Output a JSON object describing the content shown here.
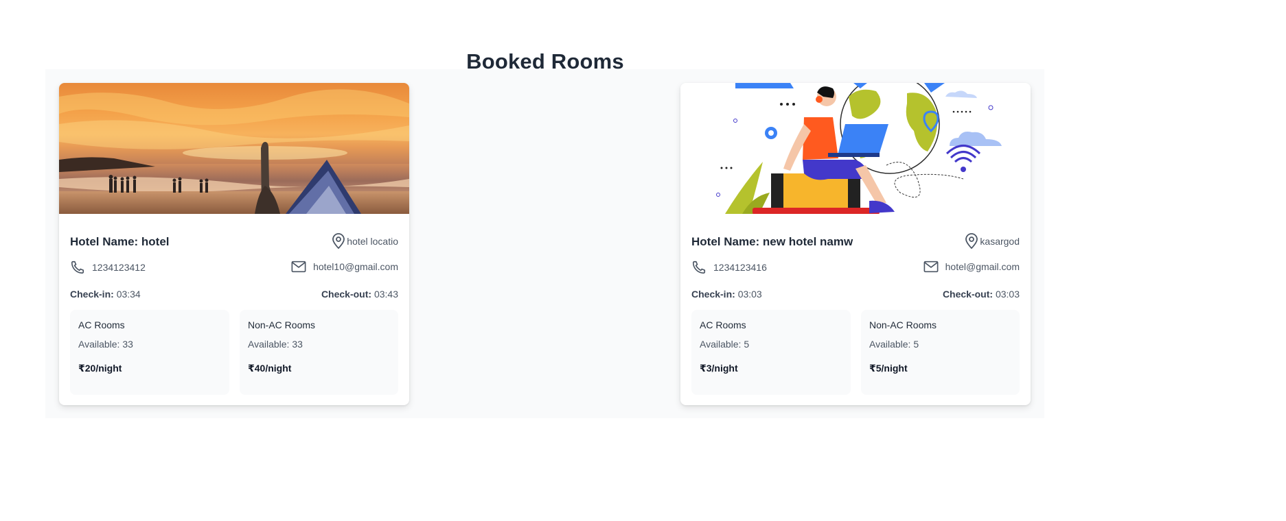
{
  "page": {
    "title": "Booked Rooms"
  },
  "bookings": [
    {
      "hotel_name": "Hotel Name: hotel",
      "location": "hotel locatio",
      "phone": "1234123412",
      "email": "hotel10@gmail.com",
      "checkin_label": "Check-in:",
      "checkin_time": "03:34",
      "checkout_label": "Check-out:",
      "checkout_time": "03:43",
      "ac": {
        "label": "AC Rooms",
        "available": "Available: 33",
        "price": "₹20/night"
      },
      "nonac": {
        "label": "Non-AC Rooms",
        "available": "Available: 33",
        "price": "₹40/night"
      },
      "image": "beach-sunset-photo"
    },
    {
      "hotel_name": "Hotel Name: new hotel namw",
      "location": "kasargod",
      "phone": "1234123416",
      "email": "hotel@gmail.com",
      "checkin_label": "Check-in:",
      "checkin_time": "03:03",
      "checkout_label": "Check-out:",
      "checkout_time": "03:03",
      "ac": {
        "label": "AC Rooms",
        "available": "Available: 5",
        "price": "₹3/night"
      },
      "nonac": {
        "label": "Non-AC Rooms",
        "available": "Available: 5",
        "price": "₹5/night"
      },
      "image": "traveler-illustration"
    }
  ],
  "icons": {
    "location": "map-pin-icon",
    "phone": "phone-icon",
    "email": "envelope-icon"
  },
  "colors": {
    "text": "#1f2937",
    "muted": "#4b5563",
    "panel": "#f9fafb",
    "icon": "#4b5563"
  }
}
